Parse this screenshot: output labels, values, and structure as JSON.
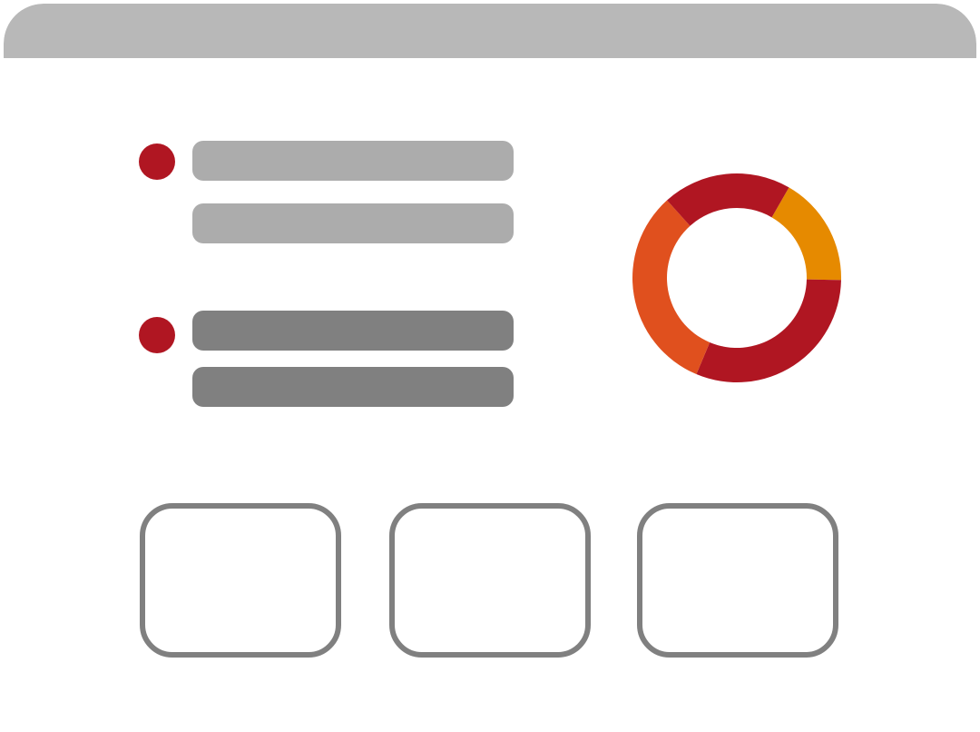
{
  "colors": {
    "titlebar": "#b8b8b8",
    "bullet": "#b01622",
    "bar_light": "#acacac",
    "bar_dark": "#808080",
    "card_border": "#808080",
    "background": "#ffffff"
  },
  "list": {
    "groups": [
      {
        "bullet_icon": "dot-icon",
        "lines": 2,
        "shade": "light"
      },
      {
        "bullet_icon": "dot-icon",
        "lines": 2,
        "shade": "dark"
      }
    ]
  },
  "donut": {
    "segments": [
      {
        "share": 0.17,
        "color": "#e68a00"
      },
      {
        "share": 0.31,
        "color": "#b01622"
      },
      {
        "share": 0.32,
        "color": "#e0501e"
      },
      {
        "share": 0.2,
        "color": "#b01622"
      }
    ]
  },
  "cards": {
    "count": 3
  }
}
